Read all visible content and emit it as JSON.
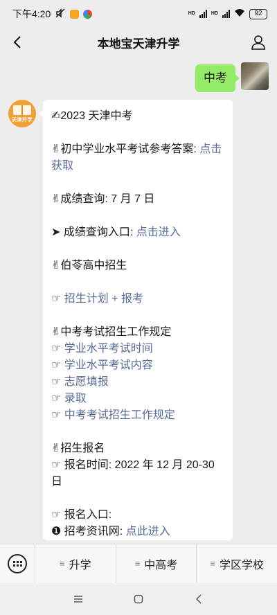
{
  "status_bar": {
    "time": "下午4:20",
    "network_type": "HD",
    "battery": "92",
    "icons": [
      "mute-icon",
      "app-notification-icon",
      "browser-notification-icon",
      "signal-icon",
      "wifi-icon",
      "battery-icon"
    ]
  },
  "header": {
    "title": "本地宝天津升学",
    "back_icon": "chevron-left-icon",
    "profile_icon": "person-icon"
  },
  "messages": {
    "outgoing": {
      "text": "中考"
    },
    "incoming": {
      "avatar_text": "天津升学",
      "l1": "✍2023 天津中考",
      "l2_a": "✌初中学业水平考试参考答案: ",
      "l2_link": "点击获取",
      "l3": "✌成绩查询: 7 月 7 日",
      "l4_a": "➤ 成绩查询入口: ",
      "l4_link": "点击进入",
      "l5": "✌伯苓高中招生",
      "l6_a": "☞ ",
      "l6_link": "招生计划 + 报考",
      "l7": "✌中考考试招生工作规定",
      "l8_a": "☞ ",
      "l8_link": "学业水平考试时间",
      "l9_a": "☞ ",
      "l9_link": "学业水平考试内容",
      "l10_a": "☞ ",
      "l10_link": "志愿填报",
      "l11_a": "☞ ",
      "l11_link": "录取",
      "l12_a": "☞ ",
      "l12_link": "中考考试招生工作规定",
      "l13": "✌招生报名",
      "l14": "☞ 报名时间: 2022 年 12 月 20-30 日",
      "l15": "☞ 报名入口:",
      "l16_a": "❶ 招考资讯网: ",
      "l16_link": "点此进入"
    }
  },
  "menu": {
    "keyboard_icon": "keyboard-icon",
    "items": [
      {
        "label": "升学"
      },
      {
        "label": "中高考"
      },
      {
        "label": "学区学校"
      }
    ]
  },
  "system_nav": {
    "menu_icon": "menu-icon",
    "home_icon": "home-icon",
    "back_icon": "back-triangle-icon"
  },
  "colors": {
    "background": "#ededed",
    "outgoing_bubble": "#95ec69",
    "incoming_bubble": "#ffffff",
    "link": "#576b95",
    "bot_avatar": "#f0a03a"
  }
}
